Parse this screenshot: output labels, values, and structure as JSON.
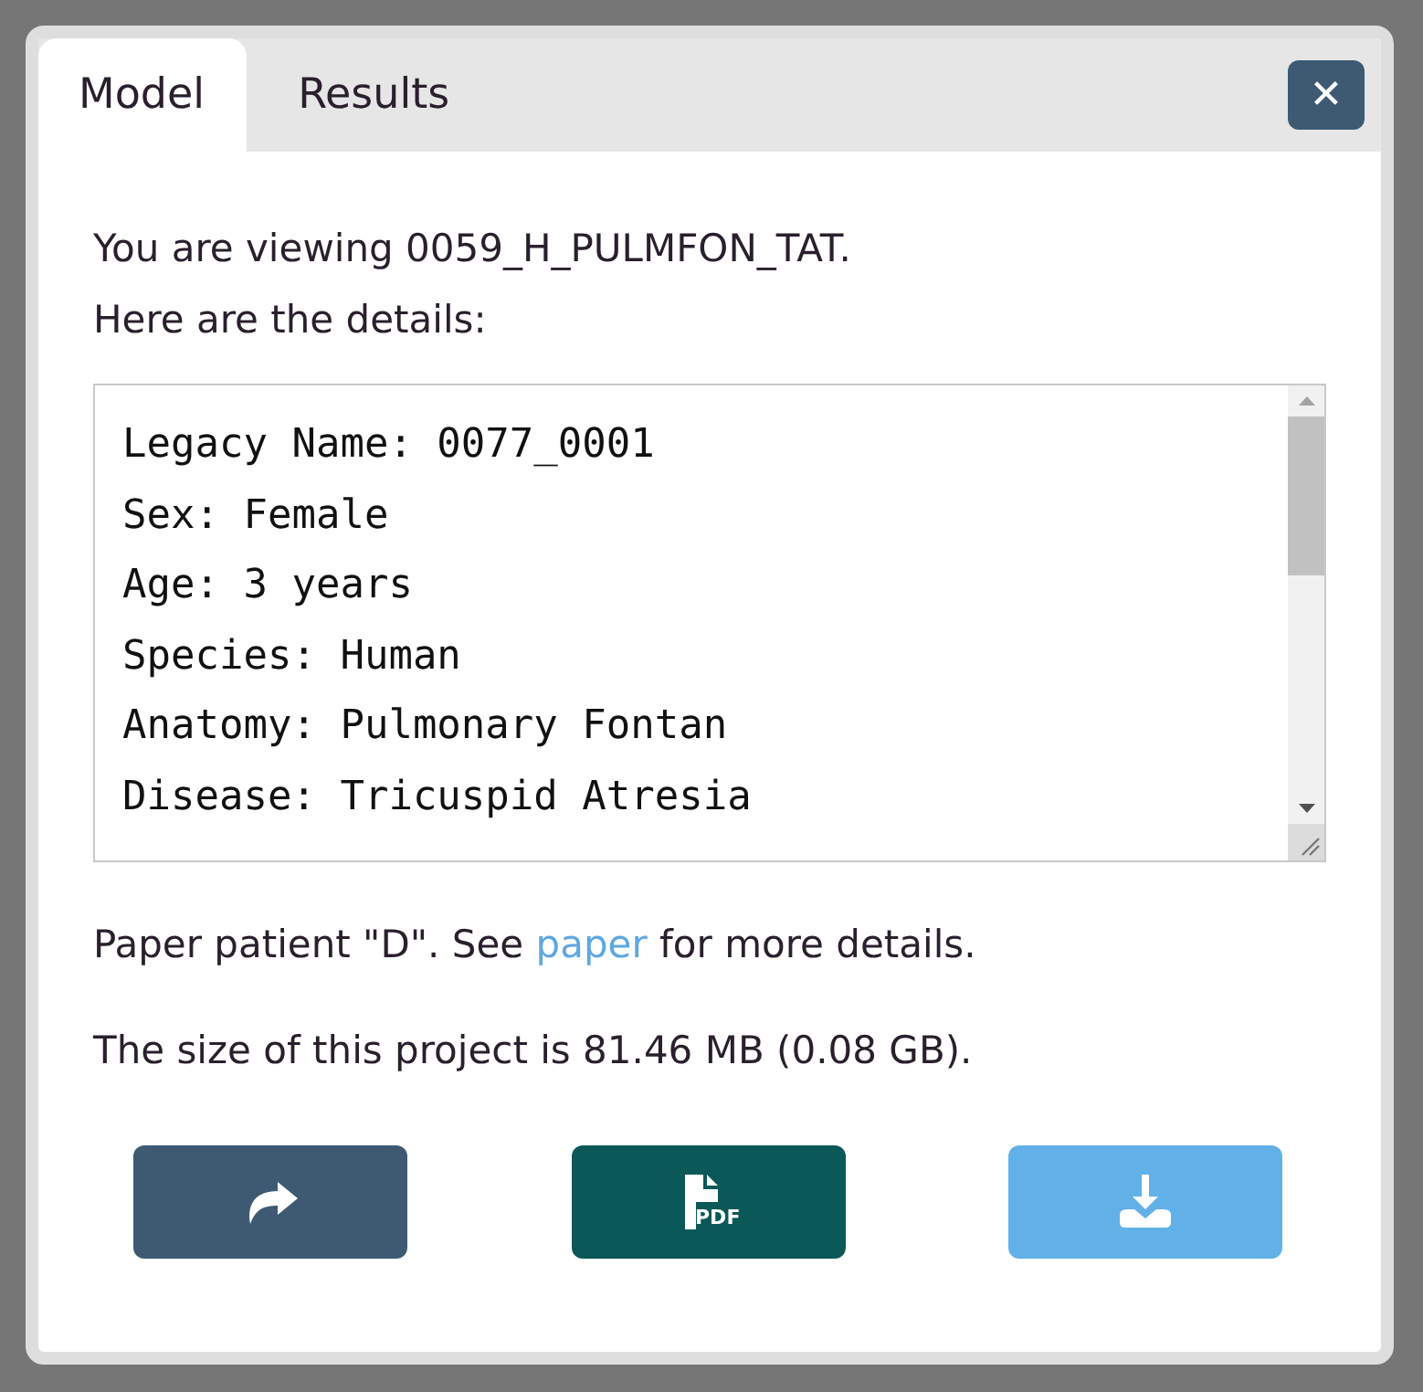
{
  "tabs": [
    {
      "label": "Model",
      "selected": true
    },
    {
      "label": "Results",
      "selected": false
    }
  ],
  "close_button": {
    "label": "✕"
  },
  "intro": [
    "You are viewing 0059_H_PULMFON_TAT.",
    "Here are the details:"
  ],
  "details": [
    "Legacy Name: 0077_0001",
    "Sex: Female",
    "Age: 3 years",
    "Species: Human",
    "Anatomy: Pulmonary Fontan",
    "Disease: Tricuspid Atresia"
  ],
  "paper_note": {
    "before": "Paper patient \"D\". See ",
    "link": "paper",
    "after": " for more details."
  },
  "size_note": "The size of this project is 81.46 MB (0.08 GB).",
  "buttons": [
    {
      "kind": "share"
    },
    {
      "kind": "pdf",
      "icon_text": "PDF"
    },
    {
      "kind": "download"
    }
  ]
}
